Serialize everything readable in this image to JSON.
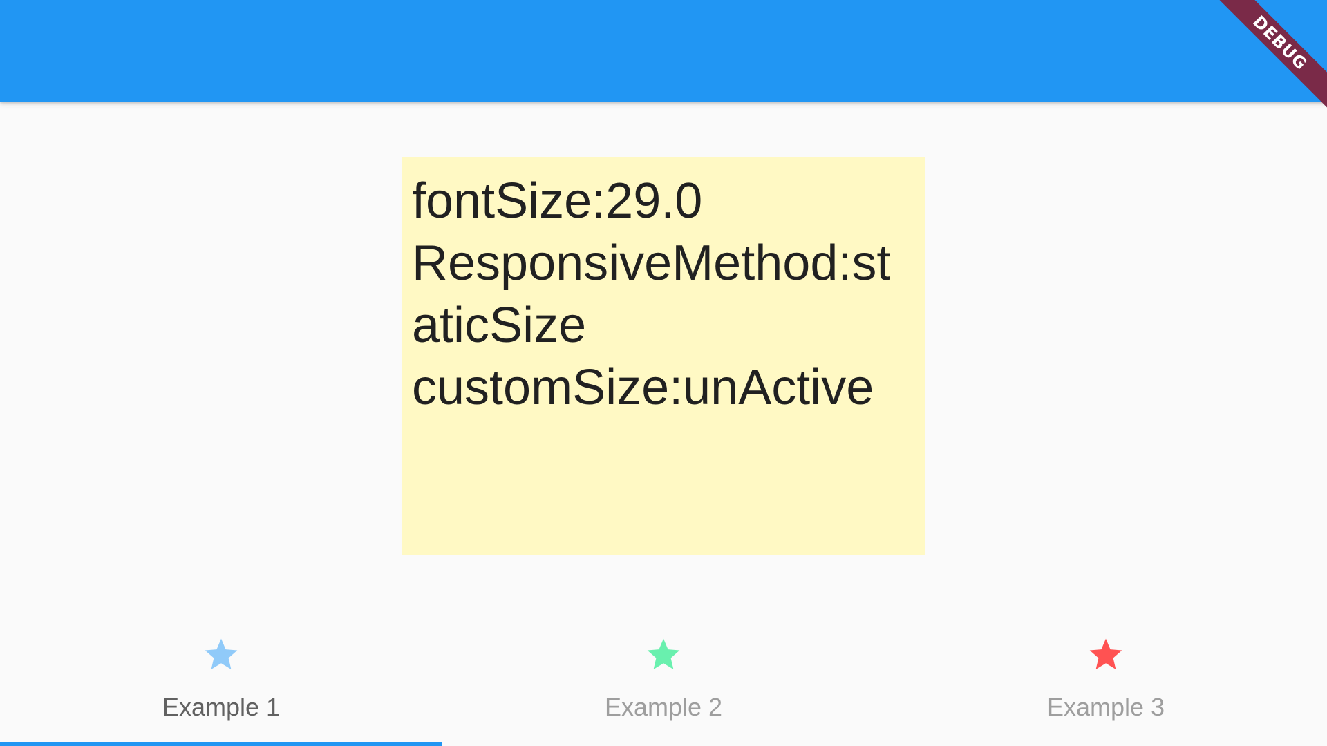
{
  "debug_banner": {
    "label": "DEBUG",
    "color": "#7A2A48"
  },
  "app_bar": {
    "color": "#2196F3"
  },
  "content": {
    "background": "#FFF9C4",
    "lines": [
      "fontSize:29.0",
      "ResponsiveMethod:st",
      "aticSize",
      "customSize:unActive"
    ]
  },
  "tabs": [
    {
      "label": "Example 1",
      "icon": "star-icon",
      "icon_color": "#90CAF9",
      "label_color": "#616161",
      "selected": true
    },
    {
      "label": "Example 2",
      "icon": "star-icon",
      "icon_color": "#69F0AE",
      "label_color": "#9E9E9E",
      "selected": false
    },
    {
      "label": "Example 3",
      "icon": "star-icon",
      "icon_color": "#FF5252",
      "label_color": "#9E9E9E",
      "selected": false
    }
  ],
  "tab_indicator_color": "#2196F3"
}
